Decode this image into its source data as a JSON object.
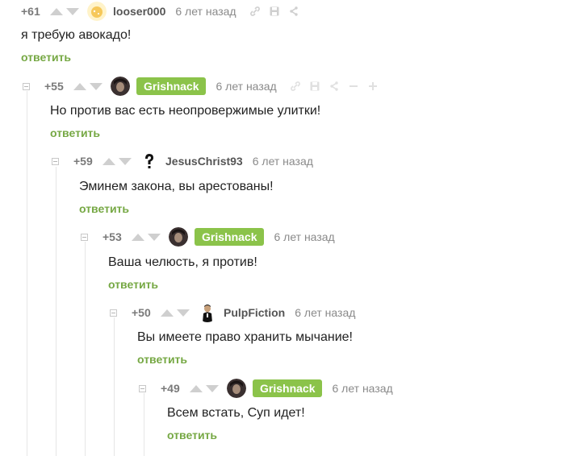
{
  "comments": [
    {
      "rating": "+61",
      "user": "looser000",
      "op": false,
      "time": "6 лет назад",
      "text": "я требую авокадо!",
      "reply": "ответить",
      "avatar": "cheese"
    },
    {
      "rating": "+55",
      "user": "Grishnack",
      "op": true,
      "time": "6 лет назад",
      "text": "Но против вас есть неопровержимые улитки!",
      "reply": "ответить",
      "avatar": "dark"
    },
    {
      "rating": "+59",
      "user": "JesusChrist93",
      "op": false,
      "time": "6 лет назад",
      "text": "Эминем закона, вы арестованы!",
      "reply": "ответить",
      "avatar": "question"
    },
    {
      "rating": "+53",
      "user": "Grishnack",
      "op": true,
      "time": "6 лет назад",
      "text": "Ваша челюсть, я против!",
      "reply": "ответить",
      "avatar": "dark"
    },
    {
      "rating": "+50",
      "user": "PulpFiction",
      "op": false,
      "time": "6 лет назад",
      "text": "Вы имеете право хранить мычание!",
      "reply": "ответить",
      "avatar": "pulp"
    },
    {
      "rating": "+49",
      "user": "Grishnack",
      "op": true,
      "time": "6 лет назад",
      "text": "Всем встать, Суп идет!",
      "reply": "ответить",
      "avatar": "dark"
    }
  ],
  "colors": {
    "accent": "#76a844",
    "op_badge": "#8bc34a",
    "muted": "#8a8a8a",
    "icon": "#cfcfcf"
  },
  "icons": [
    "link-icon",
    "save-icon",
    "share-icon",
    "minus-icon",
    "plus-icon",
    "collapse-icon",
    "vote-up-icon",
    "vote-down-icon"
  ]
}
